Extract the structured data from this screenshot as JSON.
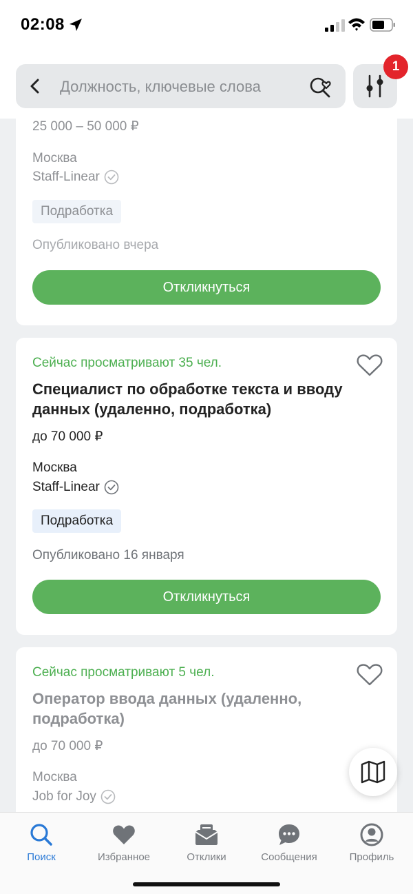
{
  "status_bar": {
    "time": "02:08"
  },
  "search": {
    "placeholder": "Должность, ключевые слова"
  },
  "filters": {
    "badge_count": "1"
  },
  "cards": [
    {
      "salary": "25 000 – 50 000 ₽",
      "city": "Москва",
      "company": "Staff-Linear",
      "tag": "Подработка",
      "published": "Опубликовано вчера",
      "button": "Откликнуться"
    },
    {
      "viewing": "Сейчас просматривают 35 чел.",
      "title": "Специалист по обработке текста и вводу данных (удаленно, подработка)",
      "salary": "до 70 000 ₽",
      "city": "Москва",
      "company": "Staff-Linear",
      "tag": "Подработка",
      "published": "Опубликовано 16 января",
      "button": "Откликнуться"
    },
    {
      "viewing": "Сейчас просматривают 5 чел.",
      "title": "Оператор ввода данных (удаленно, подработка)",
      "salary": "до 70 000 ₽",
      "city": "Москва",
      "company": "Job for Joy"
    }
  ],
  "tabs": [
    {
      "label": "Поиск",
      "icon": "search-icon",
      "active": true
    },
    {
      "label": "Избранное",
      "icon": "heart-icon"
    },
    {
      "label": "Отклики",
      "icon": "responses-icon"
    },
    {
      "label": "Сообщения",
      "icon": "chat-icon"
    },
    {
      "label": "Профиль",
      "icon": "profile-icon"
    }
  ],
  "colors": {
    "accent_green": "#5cb25c",
    "active_tab": "#2979d6",
    "badge_red": "#e3242b"
  }
}
